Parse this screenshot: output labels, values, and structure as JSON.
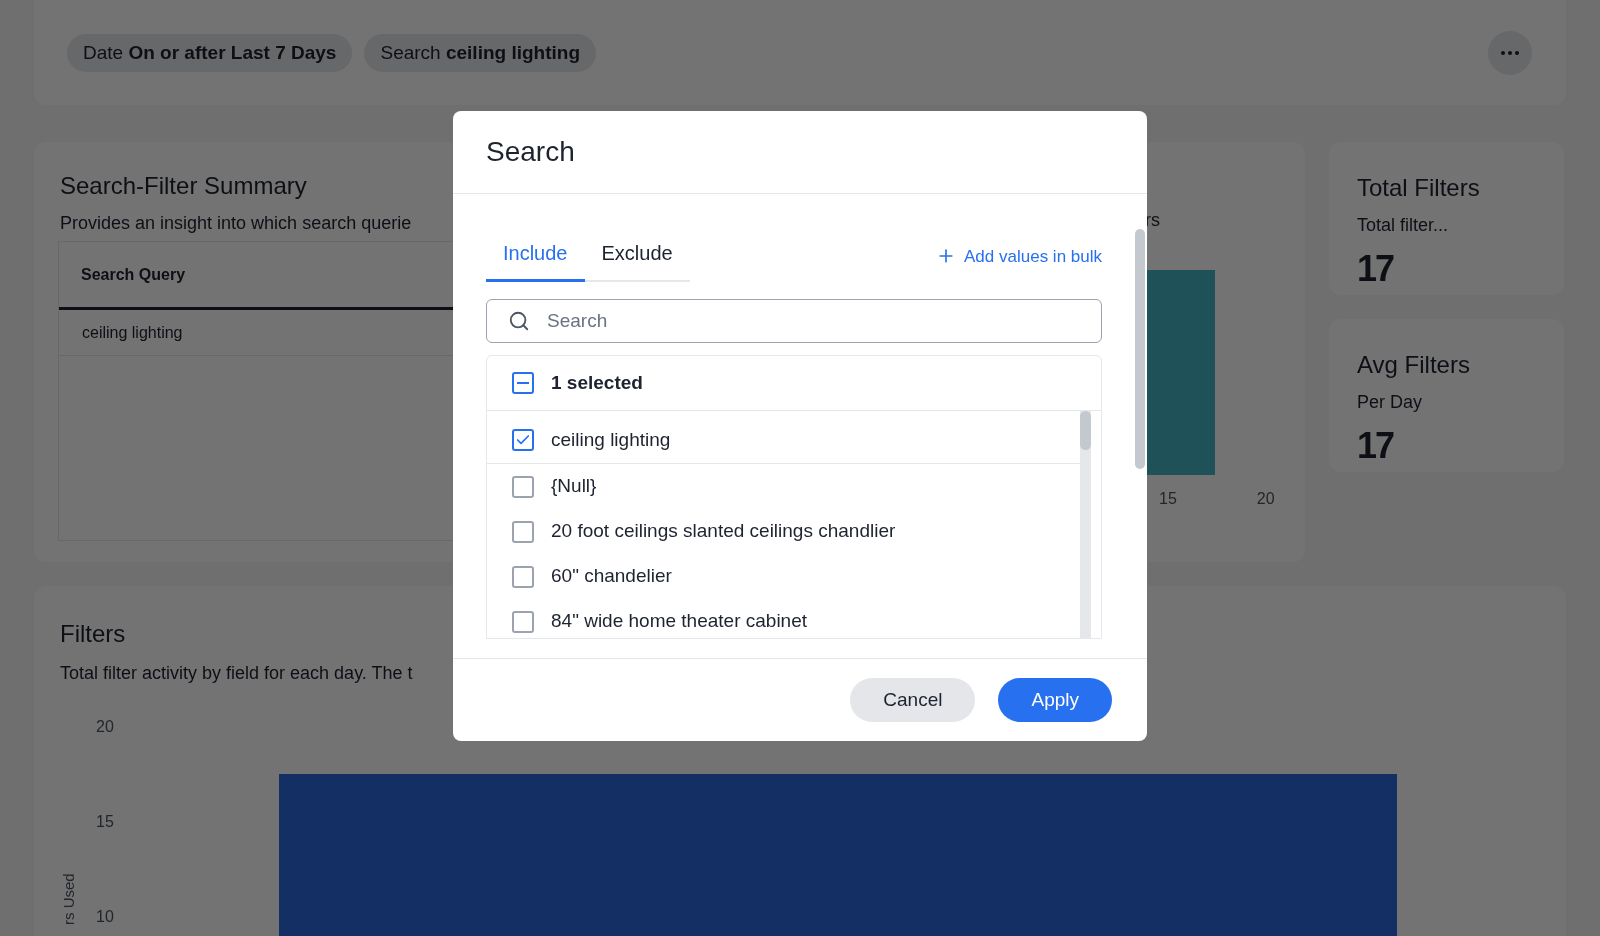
{
  "filter_bar": {
    "chips": [
      {
        "text": "Date **On or after Last 7 Days**"
      },
      {
        "text": "Search **ceiling lighting**"
      }
    ]
  },
  "summary_card": {
    "title": "Search-Filter Summary",
    "description": "Provides an insight into which search querie",
    "table": {
      "columns": [
        "Search Query"
      ],
      "rows": [
        [
          "ceiling lighting"
        ]
      ]
    },
    "chart_fragment": "rs",
    "axis_ticks": [
      "15",
      "20"
    ]
  },
  "stat_cards": [
    {
      "title": "Total Filters",
      "subtitle": "Total filter...",
      "value": "17"
    },
    {
      "title": "Avg Filters",
      "subtitle": "Per Day",
      "value": "17"
    }
  ],
  "filters_card": {
    "title": "Filters",
    "description": "Total filter activity by field for each day. The t",
    "axis_ticks": [
      "20",
      "15",
      "10"
    ],
    "axis_label": "rs Used"
  },
  "dialog": {
    "title": "Search",
    "tabs": [
      {
        "label": "Include",
        "selected": true
      },
      {
        "label": "Exclude",
        "selected": false
      }
    ],
    "bulk_link": "Add values in bulk",
    "search": {
      "placeholder": "Search"
    },
    "select_all": {
      "label": "1 selected",
      "indeterminate": true
    },
    "items": [
      {
        "label": "ceiling lighting",
        "checked": true,
        "selected": true
      },
      {
        "label": "{Null}",
        "checked": false,
        "selected": false
      },
      {
        "label": "20 foot ceilings slanted ceilings chandlier",
        "checked": false,
        "selected": false
      },
      {
        "label": "60\" chandelier",
        "checked": false,
        "selected": false
      },
      {
        "label": "84\" wide home theater cabinet",
        "checked": false,
        "selected": false
      }
    ],
    "buttons": [
      {
        "label": "Cancel",
        "kind": "secondary"
      },
      {
        "label": "Apply",
        "kind": "primary"
      }
    ]
  }
}
